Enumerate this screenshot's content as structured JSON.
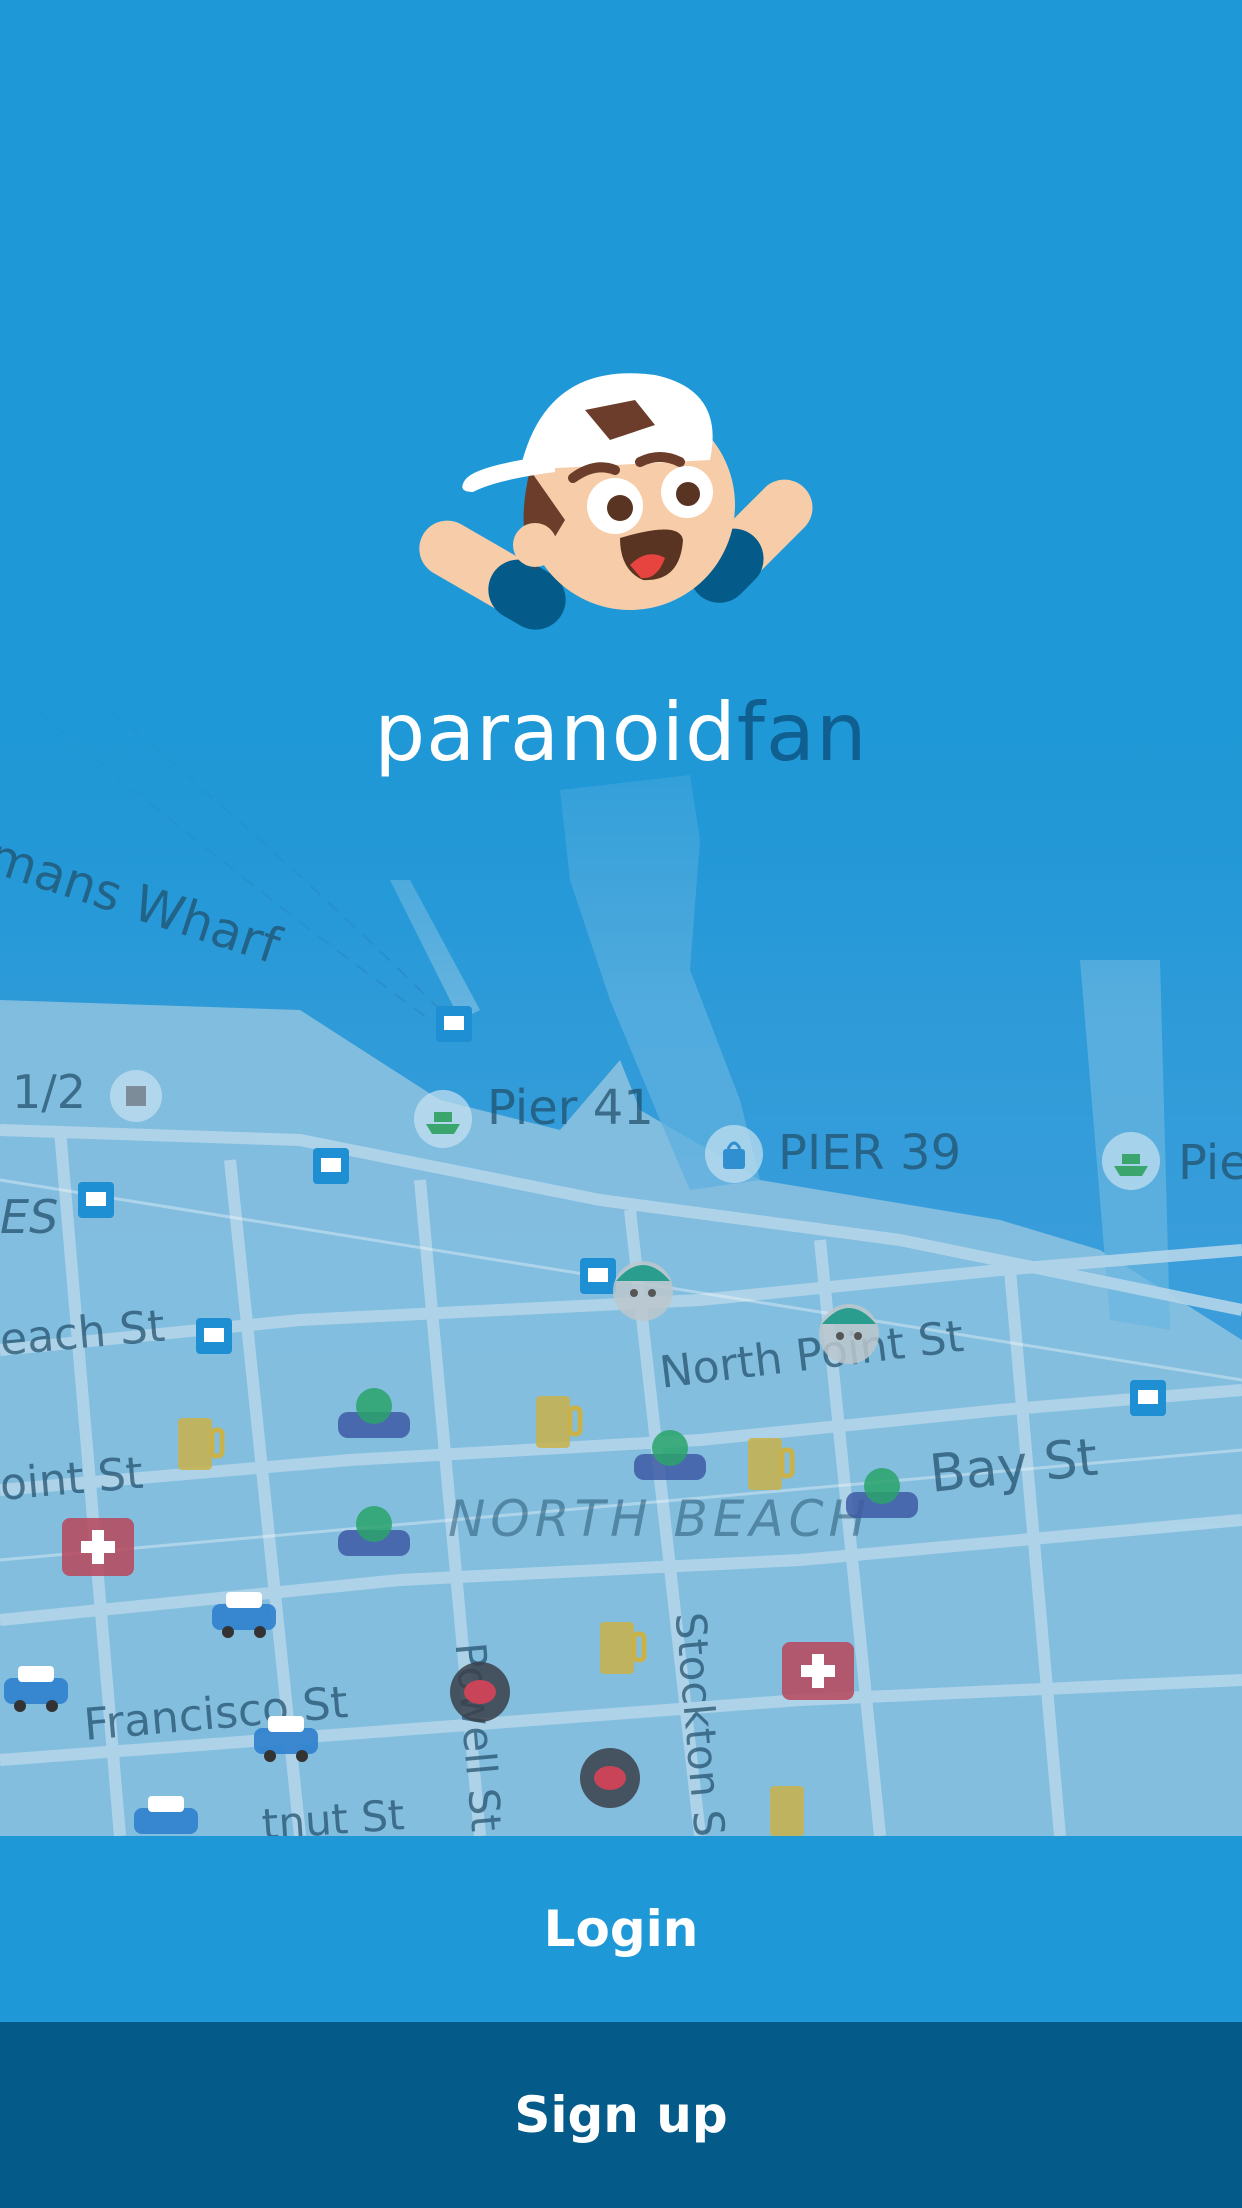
{
  "brand": {
    "part1": "paranoid",
    "part2": "fan"
  },
  "map": {
    "labels": {
      "wharf": "mans Wharf",
      "half": "1/2",
      "pier41": "Pier 41",
      "pier39": "PIER 39",
      "pier_right": "Pie",
      "es": "ES",
      "beach": "each St",
      "north_point": "North Point St",
      "point": "oint St",
      "bay": "Bay St",
      "north_beach": "NORTH BEACH",
      "powell": "Powell St",
      "stockton": "Stockton St",
      "francisco": "Francisco St",
      "chestnut": "tnut St"
    }
  },
  "actions": {
    "login_label": "Login",
    "signup_label": "Sign up"
  },
  "colors": {
    "primary": "#1e98d7",
    "dark": "#045a88",
    "brand_dark": "#0f5f91"
  }
}
